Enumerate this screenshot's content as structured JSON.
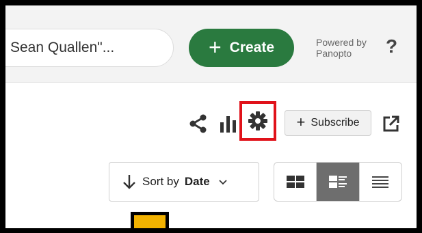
{
  "header": {
    "search_text": "Sean Quallen\"...",
    "create_label": "Create",
    "powered_by_line1": "Powered by",
    "powered_by_line2": "Panopto",
    "help_label": "?"
  },
  "toolbar": {
    "subscribe_label": "Subscribe",
    "icons": [
      "share-icon",
      "stats-icon",
      "settings-icon",
      "external-link-icon"
    ],
    "highlight_color": "#e0121a"
  },
  "sort": {
    "prefix": "Sort by",
    "value": "Date"
  },
  "view_modes": {
    "options": [
      "thumbnail-view",
      "detail-view",
      "list-view"
    ],
    "selected": "detail-view"
  },
  "colors": {
    "create_button": "#2a7a3f",
    "active_view": "#6e6e6e",
    "tab_marker": "#f2b200"
  }
}
